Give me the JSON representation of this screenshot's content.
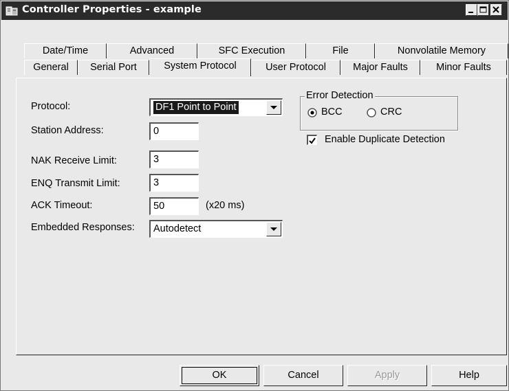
{
  "window": {
    "title": "Controller Properties - example",
    "controls": {
      "minimize": "minimize-icon",
      "maximize": "maximize-icon",
      "close": "close-icon"
    }
  },
  "tabs": {
    "back_row": [
      "Date/Time",
      "Advanced",
      "SFC Execution",
      "File",
      "Nonvolatile Memory"
    ],
    "front_row": [
      "General",
      "Serial Port",
      "System Protocol",
      "User Protocol",
      "Major Faults",
      "Minor Faults"
    ],
    "active": "System Protocol"
  },
  "form": {
    "protocol_label": "Protocol:",
    "protocol_value": "DF1 Point to Point",
    "station_label": "Station Address:",
    "station_value": "0",
    "nak_label": "NAK Receive Limit:",
    "nak_value": "3",
    "enq_label": "ENQ Transmit Limit:",
    "enq_value": "3",
    "ack_label": "ACK Timeout:",
    "ack_value": "50",
    "ack_units": "(x20 ms)",
    "embedded_label": "Embedded Responses:",
    "embedded_value": "Autodetect"
  },
  "error_detection": {
    "title": "Error Detection",
    "options": [
      "BCC",
      "CRC"
    ],
    "selected": "BCC"
  },
  "duplicate": {
    "label": "Enable Duplicate Detection",
    "checked": true
  },
  "buttons": {
    "ok": "OK",
    "cancel": "Cancel",
    "apply": "Apply",
    "help": "Help"
  },
  "colors": {
    "titlebar": "#2b2b2b",
    "face": "#e9e9e9"
  }
}
